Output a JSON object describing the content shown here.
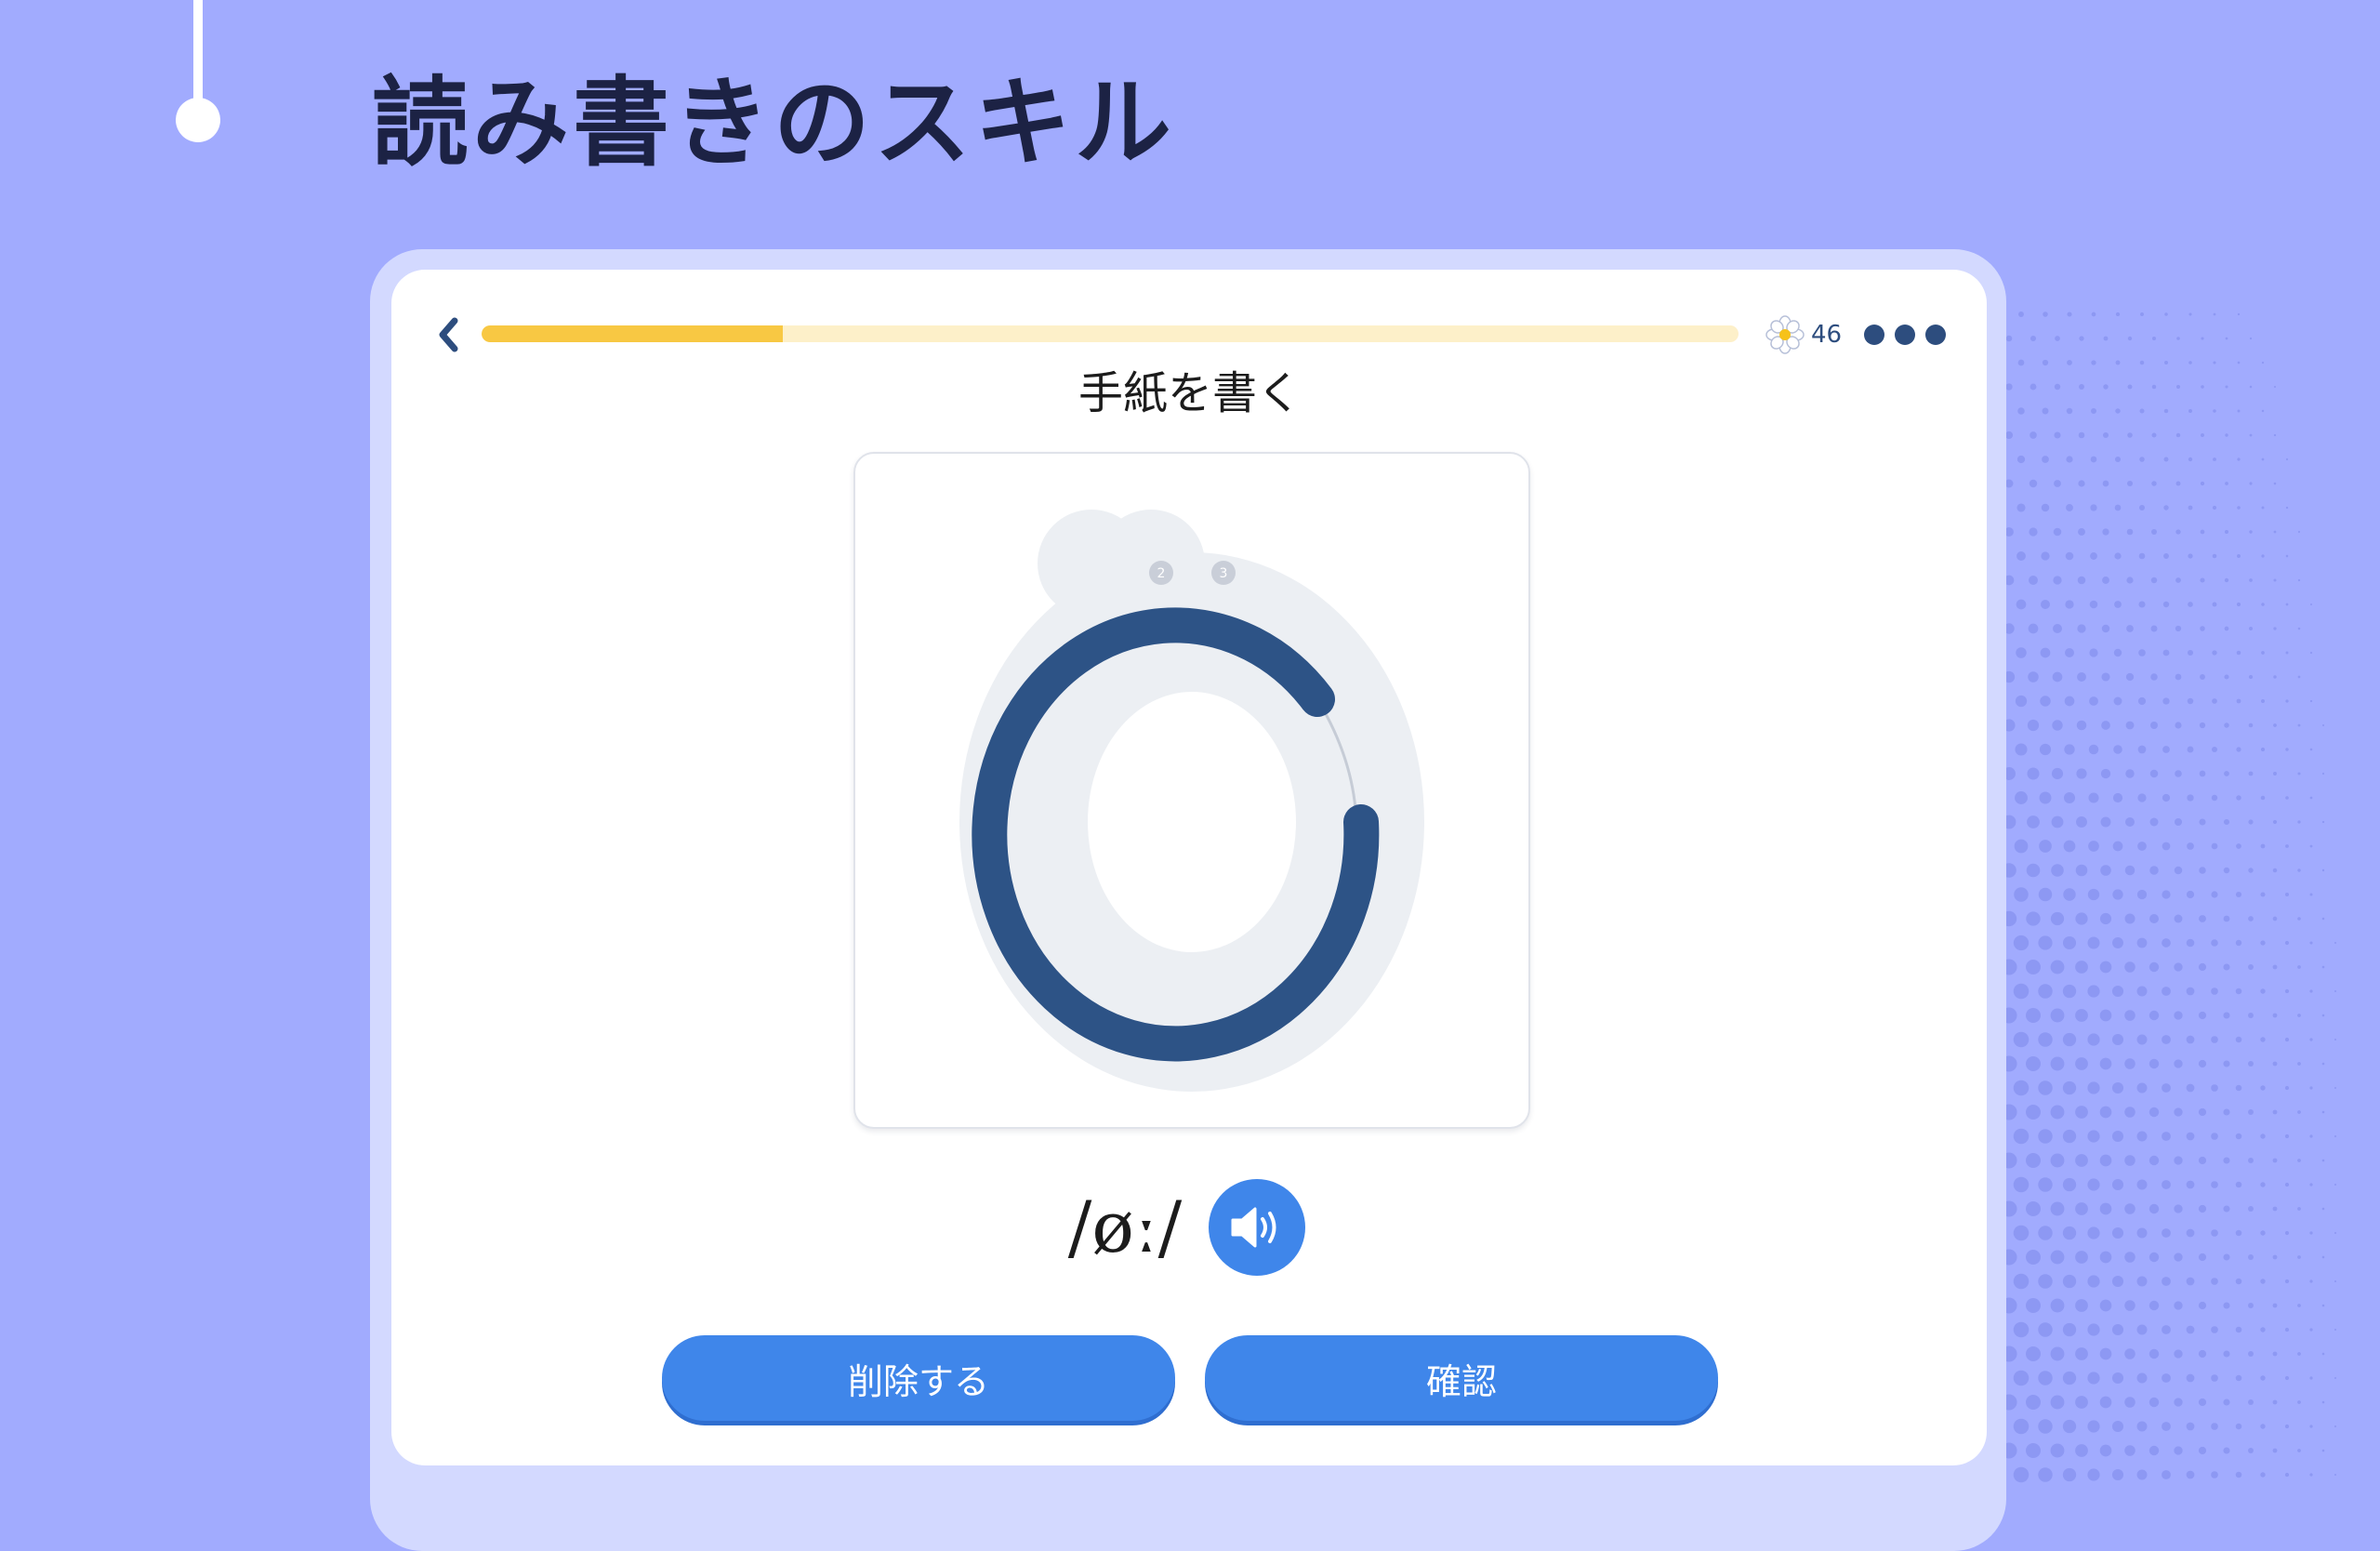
{
  "header": {
    "title": "読み書きのスキル"
  },
  "lesson": {
    "progress": 0.24,
    "points": "46",
    "exercise_title": "手紙を書く",
    "stroke_numbers": [
      "2",
      "3"
    ],
    "phonetic": "/øː/"
  },
  "buttons": {
    "delete_label": "削除する",
    "confirm_label": "確認"
  },
  "icons": {
    "back": "chevron-left-icon",
    "points": "flower-icon",
    "more": "more-dots-icon",
    "audio": "speaker-icon"
  },
  "colors": {
    "background": "#a1abfe",
    "card": "#ffffff",
    "primary_button": "#3f86ea",
    "progress_fill": "#f8c843",
    "progress_track": "#fdf0c9",
    "stroke": "#2d5386",
    "glyph_guide": "#eceff3",
    "title_text": "#1c2244"
  }
}
